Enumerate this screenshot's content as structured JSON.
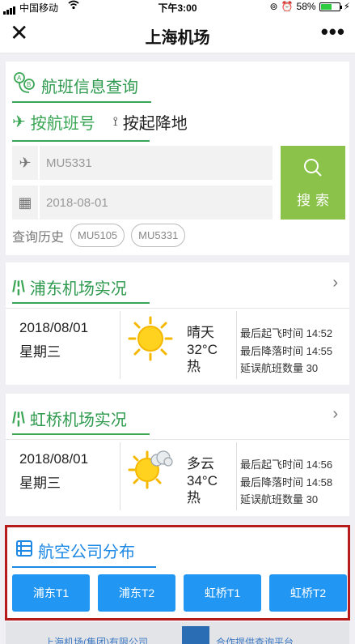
{
  "status_bar": {
    "carrier": "中国移动",
    "time": "下午3:00",
    "battery": "58%"
  },
  "nav": {
    "title": "上海机场"
  },
  "flight_query": {
    "title": "航班信息查询",
    "tabs": [
      {
        "label": "按航班号"
      },
      {
        "label": "按起降地"
      }
    ],
    "flight_no_value": "MU5331",
    "date_value": "2018-08-01",
    "search_label": "搜索",
    "history_label": "查询历史",
    "history": [
      "MU5105",
      "MU5331"
    ]
  },
  "pudong": {
    "title": "浦东机场实况",
    "date": "2018/08/01",
    "weekday": "星期三",
    "weather": "晴天",
    "temperature": "32°C",
    "feel": "热",
    "last_departure": "最后起飞时间 14:52",
    "last_arrival": "最后降落时间 14:55",
    "delayed": "延误航班数量 30"
  },
  "hongqiao": {
    "title": "虹桥机场实况",
    "date": "2018/08/01",
    "weekday": "星期三",
    "weather": "多云",
    "temperature": "34°C",
    "feel": "热",
    "last_departure": "最后起飞时间 14:56",
    "last_arrival": "最后降落时间 14:58",
    "delayed": "延误航班数量 30"
  },
  "airlines": {
    "title": "航空公司分布",
    "buttons": [
      "浦东T1",
      "浦东T2",
      "虹桥T1",
      "虹桥T2"
    ]
  },
  "footer": {
    "left": "上海机场(集团)有限公司",
    "right": "合作提供查询平台"
  }
}
